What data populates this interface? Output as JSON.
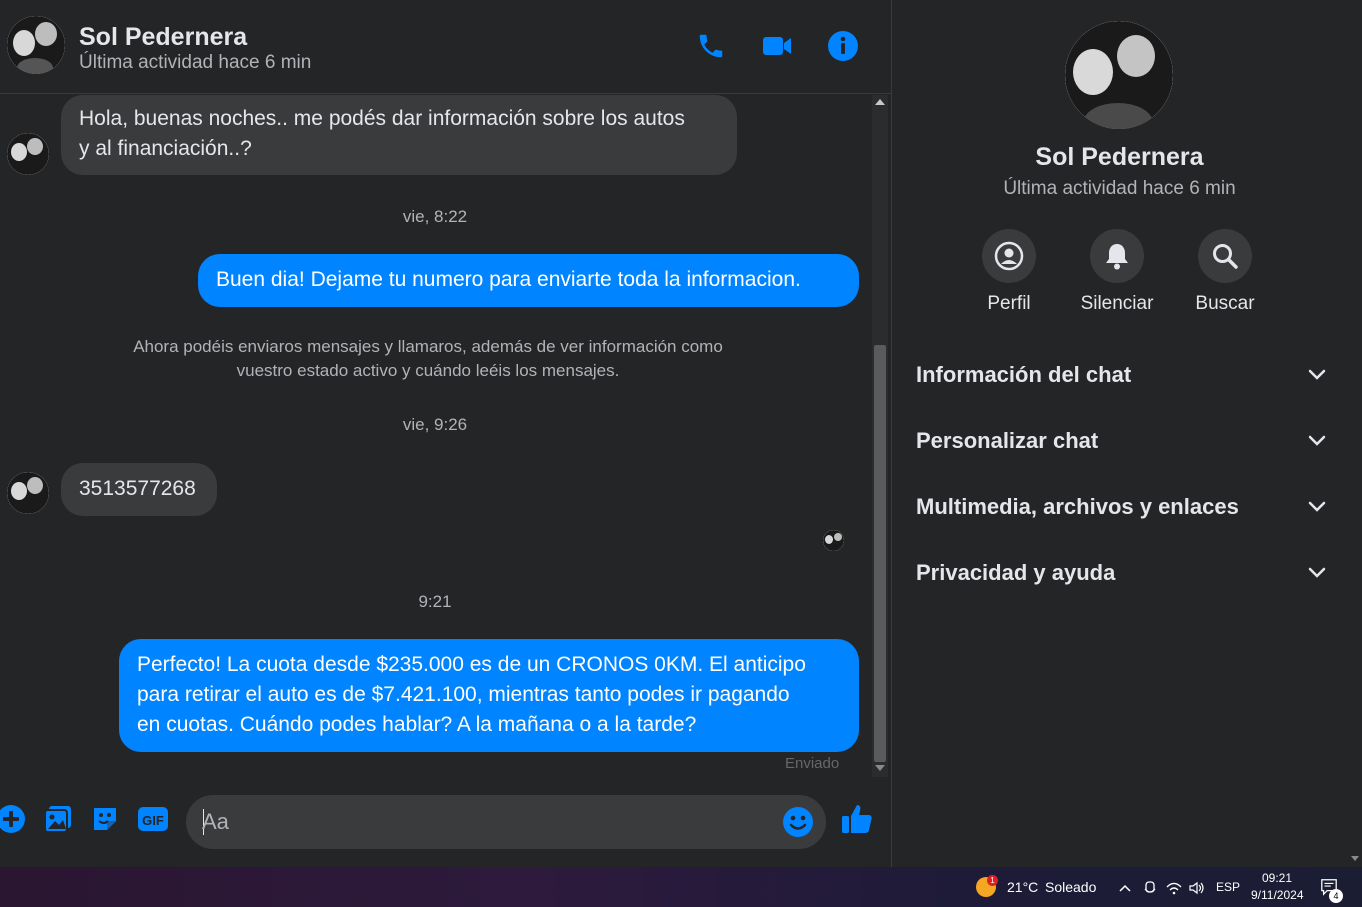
{
  "contact": {
    "name": "Sol Pedernera",
    "status": "Última actividad hace 6 min"
  },
  "header": {
    "call_icon": "phone-icon",
    "video_icon": "video-camera-icon",
    "info_icon": "info-icon"
  },
  "messages": [
    {
      "type": "incoming",
      "text_line1": "Hola, buenas noches.. me podés dar información sobre los autos",
      "text_line2": "y al financiación..?"
    },
    {
      "type": "timestamp",
      "text": "vie, 8:22"
    },
    {
      "type": "outgoing",
      "text": "Buen dia! Dejame tu numero para enviarte toda la informacion."
    },
    {
      "type": "system",
      "text_line1": "Ahora podéis enviaros mensajes y llamaros, además de ver información como",
      "text_line2": "vuestro estado activo y cuándo leéis los mensajes."
    },
    {
      "type": "timestamp",
      "text": "vie, 9:26"
    },
    {
      "type": "incoming",
      "text": "3513577268"
    },
    {
      "type": "timestamp",
      "text": "9:21"
    },
    {
      "type": "outgoing",
      "text_line1": "Perfecto! La cuota desde $235.000 es de un CRONOS 0KM. El anticipo",
      "text_line2": "para retirar el auto es de $7.421.100, mientras tanto podes ir pagando",
      "text_line3": "en cuotas. Cuándo podes hablar? A la mañana o a la tarde?"
    },
    {
      "type": "status",
      "text": "Enviado"
    }
  ],
  "composer": {
    "placeholder": "Aa",
    "gif_label": "GIF",
    "icons": [
      "plus-icon",
      "image-icon",
      "sticker-icon",
      "gif-icon",
      "emoji-icon",
      "like-icon"
    ]
  },
  "info_panel": {
    "actions": [
      {
        "label": "Perfil",
        "icon": "profile-icon"
      },
      {
        "label": "Silenciar",
        "icon": "bell-icon"
      },
      {
        "label": "Buscar",
        "icon": "search-icon"
      }
    ],
    "sections": [
      {
        "label": "Información del chat"
      },
      {
        "label": "Personalizar chat"
      },
      {
        "label": "Multimedia, archivos y enlaces"
      },
      {
        "label": "Privacidad y ayuda"
      }
    ]
  },
  "taskbar": {
    "weather_temp": "21°C",
    "weather_desc": "Soleado",
    "weather_badge": "1",
    "language": "ESP",
    "time": "09:21",
    "date": "9/11/2024",
    "notifications": "4"
  },
  "colors": {
    "accent": "#0084ff",
    "background": "#242526",
    "incoming_bubble": "#3a3b3c",
    "text": "#e4e6eb",
    "secondary_text": "#b0b3b8"
  }
}
